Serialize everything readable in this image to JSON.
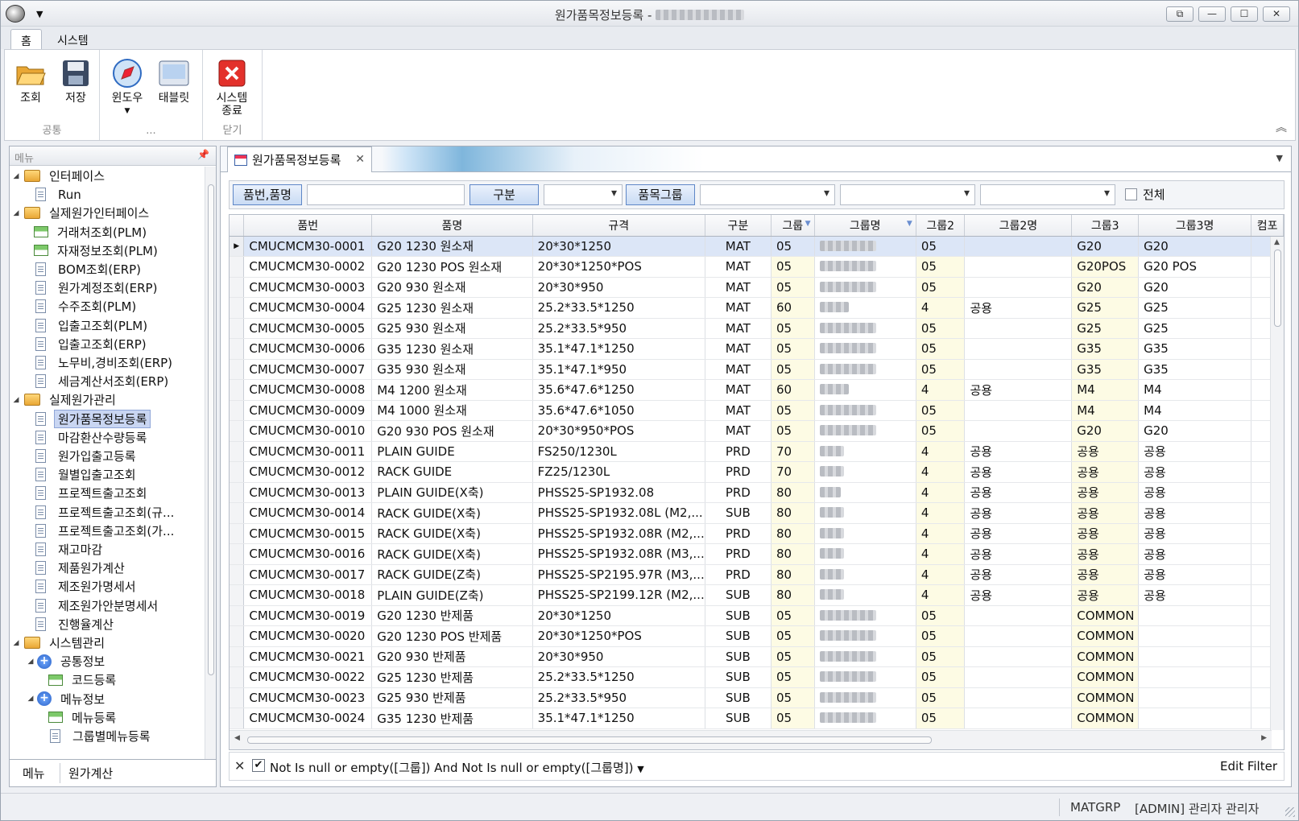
{
  "window": {
    "title": "원가품목정보등록 -",
    "controls": [
      "⧉",
      "—",
      "☐",
      "✕"
    ]
  },
  "ribbon_tabs": [
    "홈",
    "시스템"
  ],
  "ribbon": {
    "groups": [
      {
        "label": "공통",
        "buttons": [
          {
            "label": "조회",
            "icon": "folder-open-icon"
          },
          {
            "label": "저장",
            "icon": "floppy-disk-icon"
          }
        ]
      },
      {
        "label": "...",
        "buttons": [
          {
            "label": "윈도우",
            "icon": "compass-icon"
          },
          {
            "label": "태블릿",
            "icon": "tablet-icon"
          }
        ]
      },
      {
        "label": "닫기",
        "buttons": [
          {
            "label": "시스템\n종료",
            "icon": "exit-icon"
          }
        ]
      }
    ]
  },
  "left_panel": {
    "header": "메뉴",
    "tree": [
      {
        "level": 0,
        "type": "folder",
        "label": "인터페이스"
      },
      {
        "level": 1,
        "type": "doc",
        "label": "Run"
      },
      {
        "level": 0,
        "type": "folder",
        "label": "실제원가인터페이스"
      },
      {
        "level": 1,
        "type": "grid",
        "label": "거래처조회(PLM)"
      },
      {
        "level": 1,
        "type": "grid",
        "label": "자재정보조회(PLM)"
      },
      {
        "level": 1,
        "type": "doc",
        "label": "BOM조회(ERP)"
      },
      {
        "level": 1,
        "type": "doc",
        "label": "원가계정조회(ERP)"
      },
      {
        "level": 1,
        "type": "doc",
        "label": "수주조회(PLM)"
      },
      {
        "level": 1,
        "type": "doc",
        "label": "입출고조회(PLM)"
      },
      {
        "level": 1,
        "type": "doc",
        "label": "입출고조회(ERP)"
      },
      {
        "level": 1,
        "type": "doc",
        "label": "노무비,경비조회(ERP)"
      },
      {
        "level": 1,
        "type": "doc",
        "label": "세금계산서조회(ERP)"
      },
      {
        "level": 0,
        "type": "folder",
        "label": "실제원가관리"
      },
      {
        "level": 1,
        "type": "doc",
        "label": "원가품목정보등록",
        "selected": true
      },
      {
        "level": 1,
        "type": "doc",
        "label": "마감환산수량등록"
      },
      {
        "level": 1,
        "type": "doc",
        "label": "원가입출고등록"
      },
      {
        "level": 1,
        "type": "doc",
        "label": "월별입출고조회"
      },
      {
        "level": 1,
        "type": "doc",
        "label": "프로젝트출고조회"
      },
      {
        "level": 1,
        "type": "doc",
        "label": "프로젝트출고조회(규..."
      },
      {
        "level": 1,
        "type": "doc",
        "label": "프로젝트출고조회(가..."
      },
      {
        "level": 1,
        "type": "doc",
        "label": "재고마감"
      },
      {
        "level": 1,
        "type": "doc",
        "label": "제품원가계산"
      },
      {
        "level": 1,
        "type": "doc",
        "label": "제조원가명세서"
      },
      {
        "level": 1,
        "type": "doc",
        "label": "제조원가안분명세서"
      },
      {
        "level": 1,
        "type": "doc",
        "label": "진행율계산"
      },
      {
        "level": 0,
        "type": "folder",
        "label": "시스템관리"
      },
      {
        "level": 1,
        "type": "plus",
        "label": "공통정보"
      },
      {
        "level": 2,
        "type": "grid",
        "label": "코드등록"
      },
      {
        "level": 1,
        "type": "plus",
        "label": "메뉴정보"
      },
      {
        "level": 2,
        "type": "grid",
        "label": "메뉴등록"
      },
      {
        "level": 2,
        "type": "doc",
        "label": "그룹별메뉴등록"
      }
    ],
    "bottom_tabs": [
      "메뉴",
      "원가계산"
    ]
  },
  "doc_tab": {
    "label": "원가품목정보등록"
  },
  "filter": {
    "btn_item": "품번,품명",
    "btn_type": "구분",
    "btn_group": "품목그룹",
    "all_label": "전체",
    "item_value": "",
    "type_value": "",
    "group_values": [
      "",
      "",
      ""
    ]
  },
  "grid": {
    "columns": [
      "품번",
      "품명",
      "규격",
      "구분",
      "그룹",
      "그룹명",
      "그룹2",
      "그룹2명",
      "그룹3",
      "그룹3명",
      "컴포"
    ],
    "rows": [
      [
        "CMUCMCM30-0001",
        "G20 1230 원소재",
        "20*30*1250",
        "MAT",
        "05",
        "",
        "05",
        "",
        "G20",
        "G20"
      ],
      [
        "CMUCMCM30-0002",
        "G20 1230 POS 원소재",
        "20*30*1250*POS",
        "MAT",
        "05",
        "",
        "05",
        "",
        "G20POS",
        "G20 POS"
      ],
      [
        "CMUCMCM30-0003",
        "G20 930 원소재",
        "20*30*950",
        "MAT",
        "05",
        "",
        "05",
        "",
        "G20",
        "G20"
      ],
      [
        "CMUCMCM30-0004",
        "G25 1230 원소재",
        "25.2*33.5*1250",
        "MAT",
        "60",
        "",
        "4",
        "공용",
        "G25",
        "G25"
      ],
      [
        "CMUCMCM30-0005",
        "G25  930 원소재",
        "25.2*33.5*950",
        "MAT",
        "05",
        "",
        "05",
        "",
        "G25",
        "G25"
      ],
      [
        "CMUCMCM30-0006",
        "G35 1230 원소재",
        "35.1*47.1*1250",
        "MAT",
        "05",
        "",
        "05",
        "",
        "G35",
        "G35"
      ],
      [
        "CMUCMCM30-0007",
        "G35 930 원소재",
        "35.1*47.1*950",
        "MAT",
        "05",
        "",
        "05",
        "",
        "G35",
        "G35"
      ],
      [
        "CMUCMCM30-0008",
        "M4 1200 원소재",
        "35.6*47.6*1250",
        "MAT",
        "60",
        "",
        "4",
        "공용",
        "M4",
        "M4"
      ],
      [
        "CMUCMCM30-0009",
        "M4 1000 원소재",
        "35.6*47.6*1050",
        "MAT",
        "05",
        "",
        "05",
        "",
        "M4",
        "M4"
      ],
      [
        "CMUCMCM30-0010",
        "G20 930 POS 원소재",
        "20*30*950*POS",
        "MAT",
        "05",
        "",
        "05",
        "",
        "G20",
        "G20"
      ],
      [
        "CMUCMCM30-0011",
        "PLAIN GUIDE",
        "FS250/1230L",
        "PRD",
        "70",
        "",
        "4",
        "공용",
        "공용",
        "공용"
      ],
      [
        "CMUCMCM30-0012",
        "RACK GUIDE",
        "FZ25/1230L",
        "PRD",
        "70",
        "",
        "4",
        "공용",
        "공용",
        "공용"
      ],
      [
        "CMUCMCM30-0013",
        "PLAIN GUIDE(X축)",
        "PHSS25-SP1932.08",
        "PRD",
        "80",
        "",
        "4",
        "공용",
        "공용",
        "공용"
      ],
      [
        "CMUCMCM30-0014",
        "RACK GUIDE(X축)",
        "PHSS25-SP1932.08L (M2,...",
        "SUB",
        "80",
        "",
        "4",
        "공용",
        "공용",
        "공용"
      ],
      [
        "CMUCMCM30-0015",
        "RACK GUIDE(X축)",
        "PHSS25-SP1932.08R (M2,...",
        "PRD",
        "80",
        "",
        "4",
        "공용",
        "공용",
        "공용"
      ],
      [
        "CMUCMCM30-0016",
        "RACK GUIDE(X축)",
        "PHSS25-SP1932.08R (M3,...",
        "PRD",
        "80",
        "",
        "4",
        "공용",
        "공용",
        "공용"
      ],
      [
        "CMUCMCM30-0017",
        "RACK GUIDE(Z축)",
        "PHSS25-SP2195.97R (M3,...",
        "PRD",
        "80",
        "",
        "4",
        "공용",
        "공용",
        "공용"
      ],
      [
        "CMUCMCM30-0018",
        "PLAIN GUIDE(Z축)",
        "PHSS25-SP2199.12R (M2,...",
        "SUB",
        "80",
        "",
        "4",
        "공용",
        "공용",
        "공용"
      ],
      [
        "CMUCMCM30-0019",
        "G20 1230 반제품",
        "20*30*1250",
        "SUB",
        "05",
        "",
        "05",
        "",
        "COMMON",
        ""
      ],
      [
        "CMUCMCM30-0020",
        "G20 1230 POS 반제품",
        "20*30*1250*POS",
        "SUB",
        "05",
        "",
        "05",
        "",
        "COMMON",
        ""
      ],
      [
        "CMUCMCM30-0021",
        "G20 930 반제품",
        "20*30*950",
        "SUB",
        "05",
        "",
        "05",
        "",
        "COMMON",
        ""
      ],
      [
        "CMUCMCM30-0022",
        "G25 1230 반제품",
        "25.2*33.5*1250",
        "SUB",
        "05",
        "",
        "05",
        "",
        "COMMON",
        ""
      ],
      [
        "CMUCMCM30-0023",
        "G25  930 반제품",
        "25.2*33.5*950",
        "SUB",
        "05",
        "",
        "05",
        "",
        "COMMON",
        ""
      ],
      [
        "CMUCMCM30-0024",
        "G35 1230 반제품",
        "35.1*47.1*1250",
        "SUB",
        "05",
        "",
        "05",
        "",
        "COMMON",
        ""
      ]
    ],
    "selected_row": 0,
    "filter_expression": "Not Is null or empty([그룹]) And Not Is null or empty([그룹명])",
    "edit_filter": "Edit Filter"
  },
  "status": {
    "code": "MATGRP",
    "user": "[ADMIN] 관리자 관리자"
  },
  "colors": {
    "accent": "#5e87c7",
    "selection": "#dce6f7",
    "highlight_column": "#fdfbe4"
  }
}
